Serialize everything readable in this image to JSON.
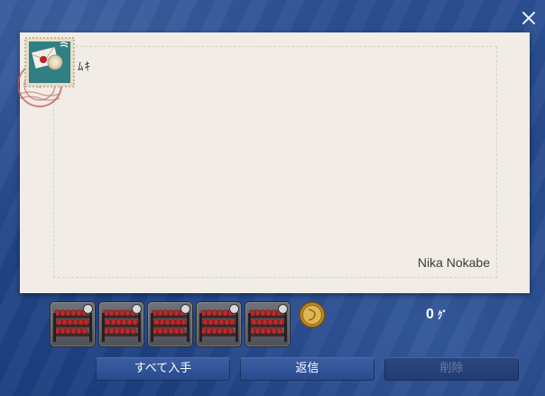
{
  "window": {
    "close_icon": "close-icon"
  },
  "letter": {
    "recipient": "ﾑｷ",
    "sender": "Nika Nokabe",
    "stamp_icon": "stamp-icon",
    "postmark_icon": "postmark-icon"
  },
  "attachments": {
    "items": [
      {
        "icon": "rack-item-icon",
        "badge_icon": "status-circle-icon"
      },
      {
        "icon": "rack-item-icon",
        "badge_icon": "status-circle-icon"
      },
      {
        "icon": "rack-item-icon",
        "badge_icon": "status-circle-icon"
      },
      {
        "icon": "rack-item-icon",
        "badge_icon": "status-circle-icon"
      },
      {
        "icon": "rack-item-icon",
        "badge_icon": "status-circle-icon"
      }
    ],
    "coin_icon": "gil-coin-icon",
    "gil_amount": "0",
    "gil_unit": "ｸﾞ"
  },
  "buttons": {
    "get_all": "すべて入手",
    "reply": "返信",
    "delete": "削除"
  },
  "colors": {
    "background": "#23478b",
    "letter_paper": "#f1ede6",
    "button": "#2f5296",
    "button_disabled_text": "#6c7da8",
    "item_red": "#c02a2a"
  }
}
